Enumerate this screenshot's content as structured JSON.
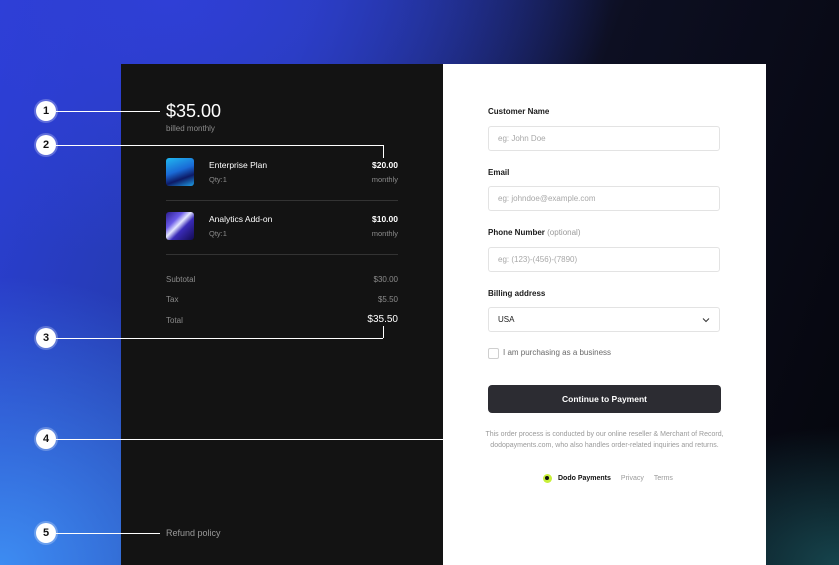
{
  "summary": {
    "price": "$35.00",
    "billed": "billed monthly",
    "items": [
      {
        "name": "Enterprise Plan",
        "qty": "Qty:1",
        "price": "$20.00",
        "period": "monthly"
      },
      {
        "name": "Analytics Add-on",
        "qty": "Qty:1",
        "price": "$10.00",
        "period": "monthly"
      }
    ],
    "subtotal_label": "Subtotal",
    "subtotal_value": "$30.00",
    "tax_label": "Tax",
    "tax_value": "$5.50",
    "total_label": "Total",
    "total_value": "$35.50",
    "refund_policy": "Refund policy"
  },
  "form": {
    "name_label": "Customer Name",
    "name_placeholder": "eg: John Doe",
    "email_label": "Email",
    "email_placeholder": "eg: johndoe@example.com",
    "phone_label": "Phone Number",
    "phone_optional": "(optional)",
    "phone_placeholder": "eg: (123)-(456)-(7890)",
    "billing_label": "Billing address",
    "billing_value": "USA",
    "business_checkbox": "I am purchasing as a business",
    "continue_button": "Continue to Payment"
  },
  "footer": {
    "disclaimer": "This order process is conducted by our online reseller & Merchant of Record, dodopayments.com, who also handles order-related inquiries and returns.",
    "brand": "Dodo Payments",
    "privacy": "Privacy",
    "terms": "Terms"
  },
  "markers": [
    "1",
    "2",
    "3",
    "4",
    "5"
  ],
  "colors": {
    "left_panel": "#131313",
    "cta": "#2c2c32",
    "accent_bg": "#2b3fd9"
  }
}
